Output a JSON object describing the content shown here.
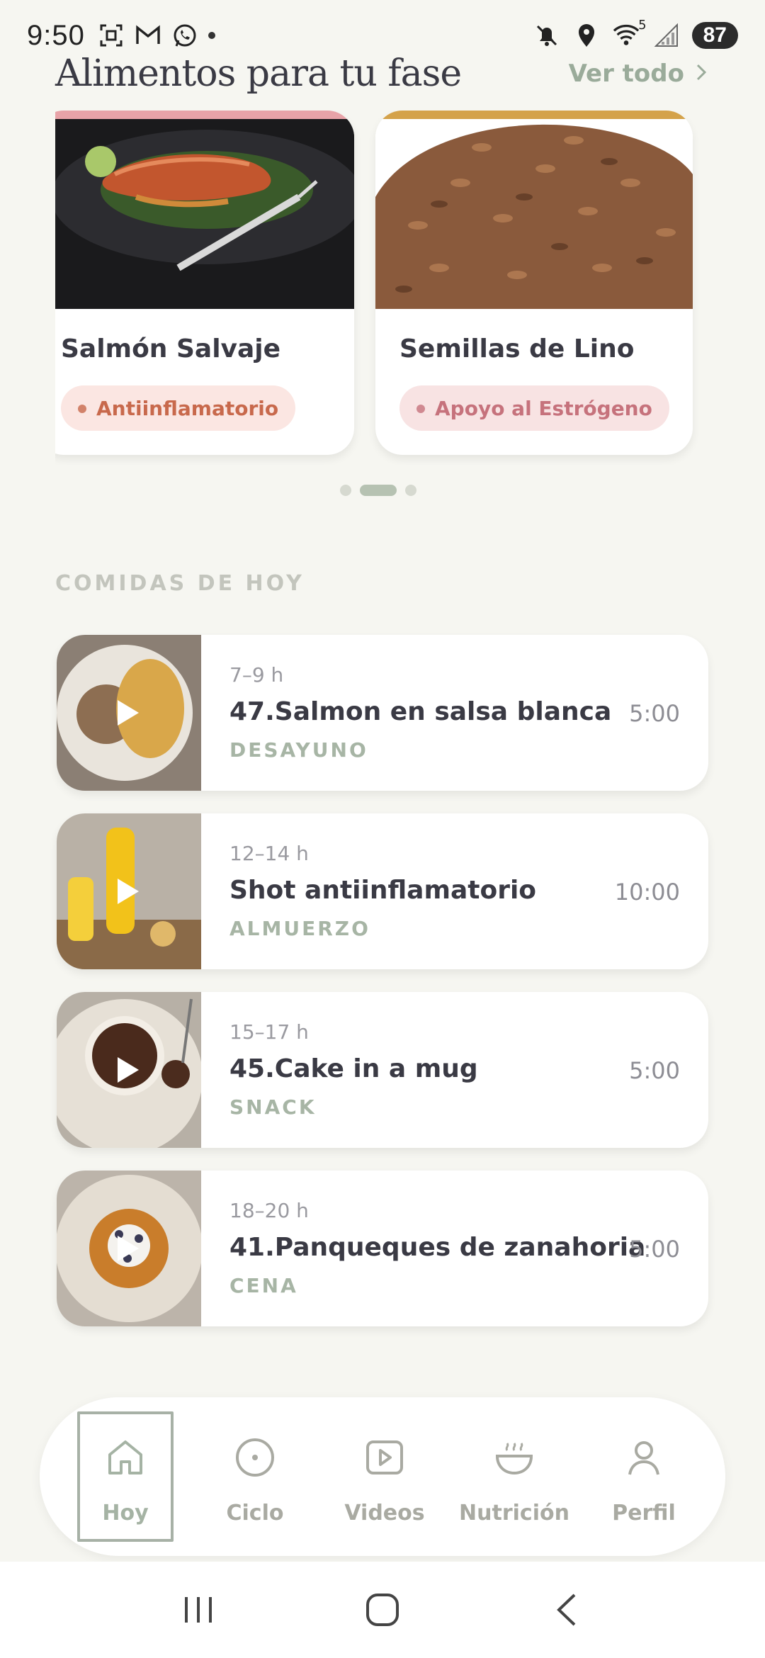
{
  "status_bar": {
    "time": "9:50",
    "battery": "87",
    "icons_left": [
      "screenshot-icon",
      "gmail-icon",
      "whatsapp-icon",
      "dot"
    ],
    "icons_right": [
      "mute-icon",
      "location-icon",
      "wifi-icon",
      "signal-icon",
      "battery-icon"
    ],
    "wifi_label": "5"
  },
  "header": {
    "title": "Alimentos para tu fase",
    "see_all": "Ver todo"
  },
  "foods": [
    {
      "name": "Salmón Salvaje",
      "tag": "Antiinflamatorio",
      "accent": "#e8a3a8",
      "tag_bg": "#fbe6e2",
      "tag_color": "#c8694c"
    },
    {
      "name": "Semillas de Lino",
      "tag": "Apoyo al Estrógeno",
      "accent": "#d4a24a",
      "tag_bg": "#f8e3e3",
      "tag_color": "#c6727c"
    }
  ],
  "pager": {
    "count": 3,
    "active": 1
  },
  "meals_section": {
    "label": "COMIDAS DE HOY"
  },
  "meals": [
    {
      "time": "7–9 h",
      "title": "47.Salmon en salsa blanca",
      "type": "DESAYUNO",
      "duration": "5:00"
    },
    {
      "time": "12–14 h",
      "title": "Shot antiinflamatorio",
      "type": "ALMUERZO",
      "duration": "10:00"
    },
    {
      "time": "15–17 h",
      "title": "45.Cake in a mug",
      "type": "SNACK",
      "duration": "5:00"
    },
    {
      "time": "18–20 h",
      "title": "41.Panqueques de zanahoria",
      "type": "CENA",
      "duration": "5:00"
    }
  ],
  "nav": [
    {
      "label": "Hoy",
      "icon": "home-icon",
      "active": true
    },
    {
      "label": "Ciclo",
      "icon": "cycle-icon",
      "active": false
    },
    {
      "label": "Videos",
      "icon": "video-icon",
      "active": false
    },
    {
      "label": "Nutrición",
      "icon": "bowl-icon",
      "active": false
    },
    {
      "label": "Perfil",
      "icon": "profile-icon",
      "active": false
    }
  ],
  "colors": {
    "background": "#f6f6f1",
    "accent_green": "#a7b5a5",
    "text_dark": "#3a3a44"
  }
}
